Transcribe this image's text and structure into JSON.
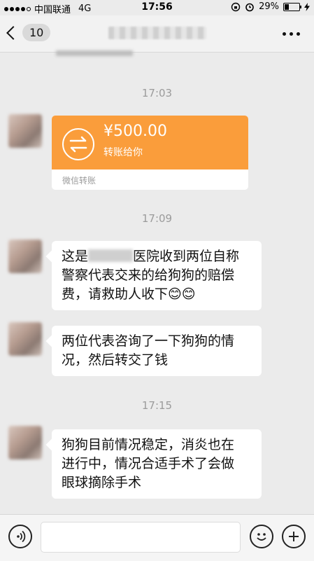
{
  "status_bar": {
    "carrier": "中国联通",
    "network": "4G",
    "time": "17:56",
    "battery": "29%"
  },
  "nav": {
    "unread_count": "10"
  },
  "messages": {
    "ts1": "17:03",
    "transfer": {
      "amount": "¥500.00",
      "subtitle": "转账给你",
      "footer": "微信转账"
    },
    "ts2": "17:09",
    "m1_prefix": "这是",
    "m1_line1_rest": "医院收到两位自称",
    "m1_line2": "警察代表交来的给狗狗的赔偿",
    "m1_line3": "费，请救助人收下😊😊",
    "m2_line1": "两位代表咨询了一下狗狗的情",
    "m2_line2": "况，然后转交了钱",
    "ts3": "17:15",
    "m3_line1": "狗狗目前情况稳定，消炎也在",
    "m3_line2": "进行中，情况合适手术了会做",
    "m3_line3": "眼球摘除手术"
  },
  "icons": {
    "back": "chevron-left-icon",
    "more": "more-dots-icon",
    "voice": "voice-icon",
    "emoji": "emoji-icon",
    "add": "plus-icon",
    "transfer": "transfer-arrows-icon"
  },
  "colors": {
    "transfer_orange": "#fa9d3b",
    "chat_background": "#ebebeb"
  }
}
